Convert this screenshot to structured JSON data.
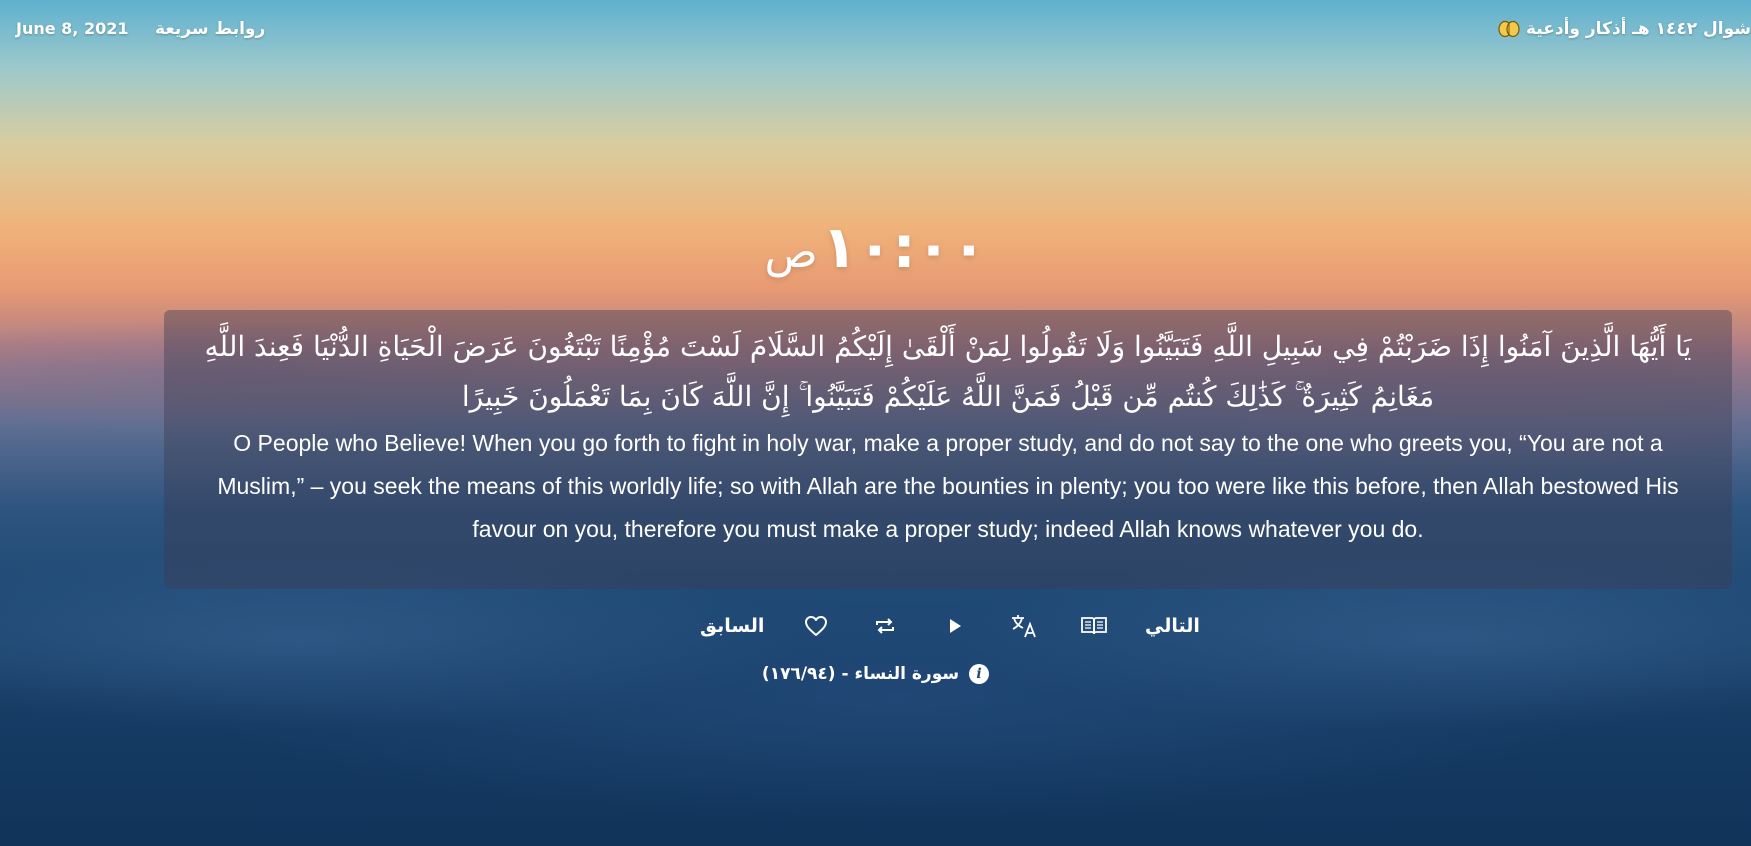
{
  "topbar": {
    "date": "June 8, 2021",
    "quick_links_label": "روابط سريعة",
    "adhkar_label": "أذكار وأدعية",
    "hijri_date": "شوال ١٤٤٢ هـ"
  },
  "clock": {
    "time": "١٠:٠٠",
    "period": "ص"
  },
  "verse": {
    "arabic_line_1": "يَا أَيُّهَا الَّذِينَ آمَنُوا إِذَا ضَرَبْتُمْ فِي سَبِيلِ اللَّهِ فَتَبَيَّنُوا وَلَا تَقُولُوا لِمَنْ أَلْقَىٰ إِلَيْكُمُ السَّلَامَ لَسْتَ مُؤْمِنًا تَبْتَغُونَ عَرَضَ الْحَيَاةِ الدُّنْيَا فَعِندَ اللَّهِ",
    "arabic_line_2": "مَغَانِمُ كَثِيرَةٌ ۚ كَذَٰلِكَ كُنتُم مِّن قَبْلُ فَمَنَّ اللَّهُ عَلَيْكُمْ فَتَبَيَّنُوا ۚ إِنَّ اللَّهَ كَانَ بِمَا تَعْمَلُونَ خَبِيرًا",
    "translation": "O People who Believe! When you go forth to fight in holy war, make a proper study, and do not say to the one who greets you, “You are not a Muslim,” – you seek the means of this worldly life; so with Allah are the bounties in plenty; you too were like this before, then Allah bestowed His favour on you, therefore you must make a proper study; indeed Allah knows whatever you do."
  },
  "controls": {
    "previous_label": "السابق",
    "next_label": "التالي",
    "icons": [
      "heart-icon",
      "repeat-icon",
      "play-icon",
      "translate-icon",
      "book-icon"
    ]
  },
  "surah": {
    "reference": "سورة النساء - (١٧٦/٩٤)",
    "info_glyph": "i"
  },
  "colors": {
    "accent_icon": "#f2c94c",
    "verse_box": "rgba(60,60,80,0.42)",
    "text": "#ffffff"
  }
}
